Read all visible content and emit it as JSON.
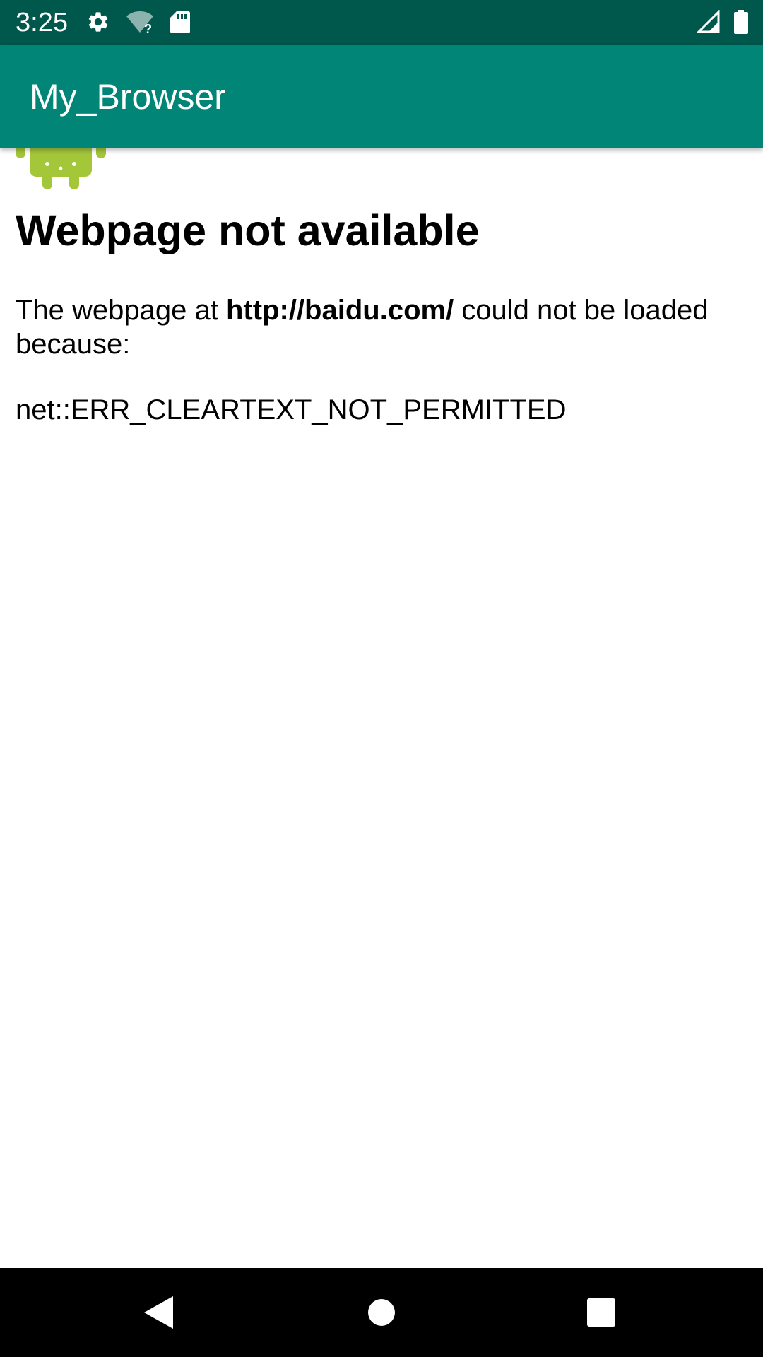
{
  "status_bar": {
    "time": "3:25",
    "icons": [
      "gear-icon",
      "wifi-unknown-icon",
      "sd-card-icon",
      "cell-signal-icon",
      "battery-icon"
    ],
    "background_color": "#00574b"
  },
  "app_bar": {
    "title": "My_Browser",
    "background_color": "#008577"
  },
  "web_page": {
    "logo_icon": "android-robot-icon",
    "heading": "Webpage not available",
    "message_prefix": "The webpage at ",
    "url": "http://baidu.com/",
    "message_suffix": " could not be loaded because:",
    "error_code": "net::ERR_CLEARTEXT_NOT_PERMITTED",
    "logo_color": "#a4c639"
  },
  "nav_bar": {
    "buttons": [
      "back-icon",
      "home-icon",
      "recents-icon"
    ]
  }
}
